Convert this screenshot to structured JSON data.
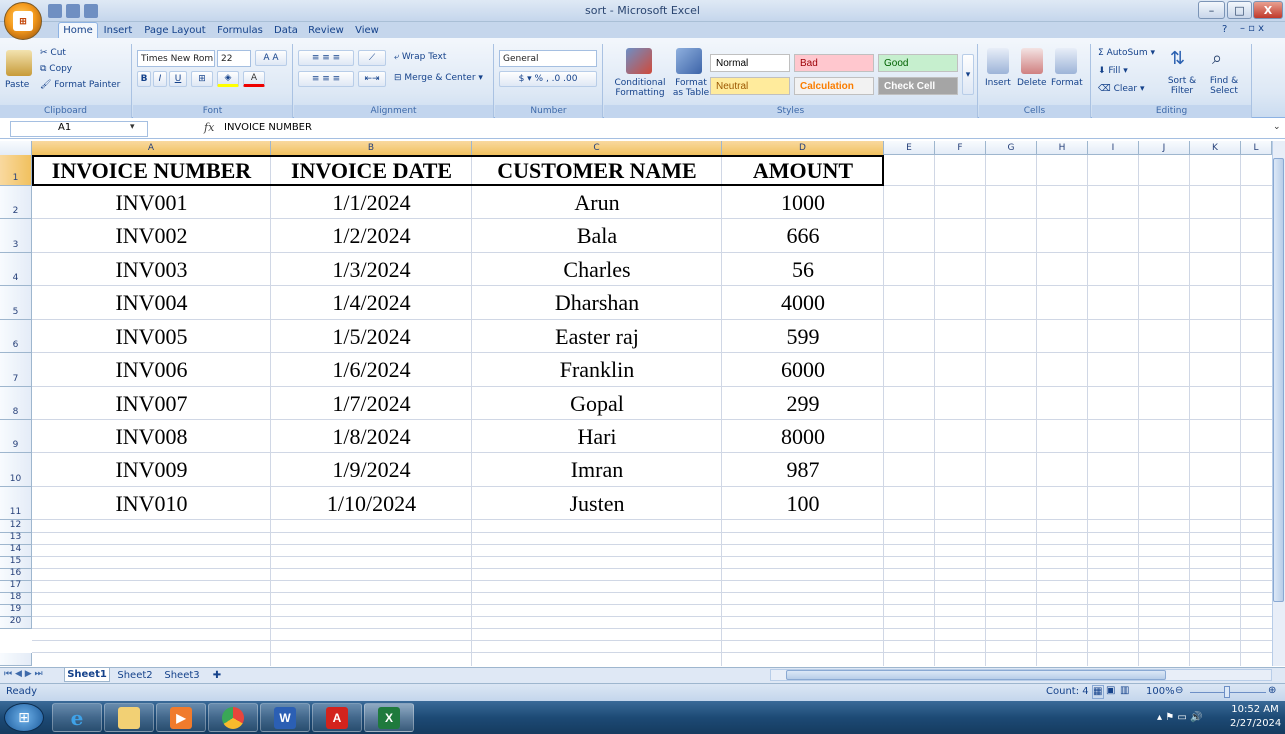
{
  "window": {
    "title": "sort - Microsoft Excel",
    "controls": {
      "minimize": "–",
      "maximize": "□",
      "close": "X"
    }
  },
  "ribbon_tabs": [
    "Home",
    "Insert",
    "Page Layout",
    "Formulas",
    "Data",
    "Review",
    "View"
  ],
  "active_tab": "Home",
  "ribbon": {
    "clipboard": {
      "paste": "Paste",
      "cut": "Cut",
      "copy": "Copy",
      "format_painter": "Format Painter",
      "label": "Clipboard"
    },
    "font": {
      "name": "Times New Rom",
      "size": "22",
      "label": "Font"
    },
    "alignment": {
      "wrap_text": "Wrap Text",
      "merge_center": "Merge & Center",
      "label": "Alignment"
    },
    "number": {
      "format": "General",
      "label": "Number"
    },
    "styles": {
      "conditional_formatting": "Conditional Formatting",
      "format_as_table": "Format as Table",
      "cells": [
        {
          "name": "Normal",
          "bg": "#ffffff",
          "fg": "#000000"
        },
        {
          "name": "Bad",
          "bg": "#ffc7ce",
          "fg": "#9c0006"
        },
        {
          "name": "Good",
          "bg": "#c6efce",
          "fg": "#006100"
        },
        {
          "name": "Neutral",
          "bg": "#ffeb9c",
          "fg": "#9c5700"
        },
        {
          "name": "Calculation",
          "bg": "#f2f2f2",
          "fg": "#fa7d00"
        },
        {
          "name": "Check Cell",
          "bg": "#a5a5a5",
          "fg": "#ffffff"
        }
      ],
      "label": "Styles"
    },
    "cells": {
      "insert": "Insert",
      "delete": "Delete",
      "format": "Format",
      "label": "Cells"
    },
    "editing": {
      "autosum": "AutoSum",
      "fill": "Fill",
      "clear": "Clear",
      "sort_filter": "Sort & Filter",
      "find_select": "Find & Select",
      "label": "Editing"
    }
  },
  "formula_bar": {
    "cell_ref": "A1",
    "fx": "fx",
    "value": "INVOICE NUMBER"
  },
  "columns": [
    "A",
    "B",
    "C",
    "D",
    "E",
    "F",
    "G",
    "H",
    "I",
    "J",
    "K",
    "L"
  ],
  "headers": [
    "INVOICE NUMBER",
    "INVOICE DATE",
    "CUSTOMER NAME",
    "AMOUNT"
  ],
  "rows": [
    {
      "num": "2",
      "cells": [
        "INV001",
        "1/1/2024",
        "Arun",
        "1000"
      ]
    },
    {
      "num": "3",
      "cells": [
        "INV002",
        "1/2/2024",
        "Bala",
        "666"
      ]
    },
    {
      "num": "4",
      "cells": [
        "INV003",
        "1/3/2024",
        "Charles",
        "56"
      ]
    },
    {
      "num": "5",
      "cells": [
        "INV004",
        "1/4/2024",
        "Dharshan",
        "4000"
      ]
    },
    {
      "num": "6",
      "cells": [
        "INV005",
        "1/5/2024",
        "Easter raj",
        "599"
      ]
    },
    {
      "num": "7",
      "cells": [
        "INV006",
        "1/6/2024",
        "Franklin",
        "6000"
      ]
    },
    {
      "num": "8",
      "cells": [
        "INV007",
        "1/7/2024",
        "Gopal",
        "299"
      ]
    },
    {
      "num": "9",
      "cells": [
        "INV008",
        "1/8/2024",
        "Hari",
        "8000"
      ]
    },
    {
      "num": "10",
      "cells": [
        "INV009",
        "1/9/2024",
        "Imran",
        "987"
      ]
    },
    {
      "num": "11",
      "cells": [
        "INV010",
        "1/10/2024",
        "Justen",
        "100"
      ]
    }
  ],
  "header_row_num": "1",
  "empty_rows": [
    "12",
    "13",
    "14",
    "15",
    "16",
    "17",
    "18",
    "19",
    "20"
  ],
  "sheets": [
    "Sheet1",
    "Sheet2",
    "Sheet3"
  ],
  "active_sheet": "Sheet1",
  "status": {
    "ready": "Ready",
    "count": "Count: 4",
    "zoom": "100%"
  },
  "taskbar": {
    "time": "10:52 AM",
    "date": "2/27/2024"
  }
}
